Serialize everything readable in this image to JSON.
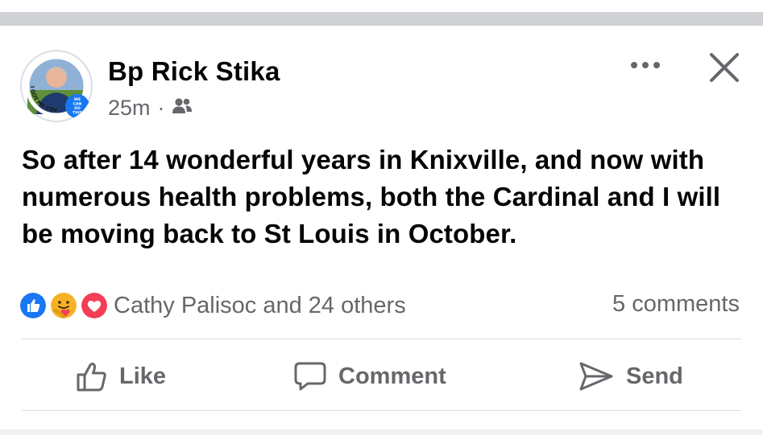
{
  "post": {
    "author": "Bp Rick Stika",
    "time": "25m",
    "separator": "·",
    "audience_icon": "friends-icon",
    "text": "So after 14 wonderful years in Knixville, and now with\nnumerous health problems, both the Cardinal and I will\nbe moving back to St Louis in October.",
    "avatar_badge": {
      "ring_text": "I GOT MY COVID-19 VACCINE",
      "badge_lines": [
        "WE",
        "CAN",
        "DO",
        "THIS"
      ]
    }
  },
  "reactions": {
    "icons": [
      "like-reaction-icon",
      "care-reaction-icon",
      "love-reaction-icon"
    ],
    "summary": "Cathy Palisoc and 24 others",
    "comments": "5 comments"
  },
  "actions": {
    "like": "Like",
    "comment": "Comment",
    "send": "Send"
  },
  "colors": {
    "like_blue": "#1877f2",
    "love_red": "#f33e58",
    "care_yellow": "#f7b125",
    "secondary_text": "#65676b",
    "primary_text": "#050505"
  }
}
